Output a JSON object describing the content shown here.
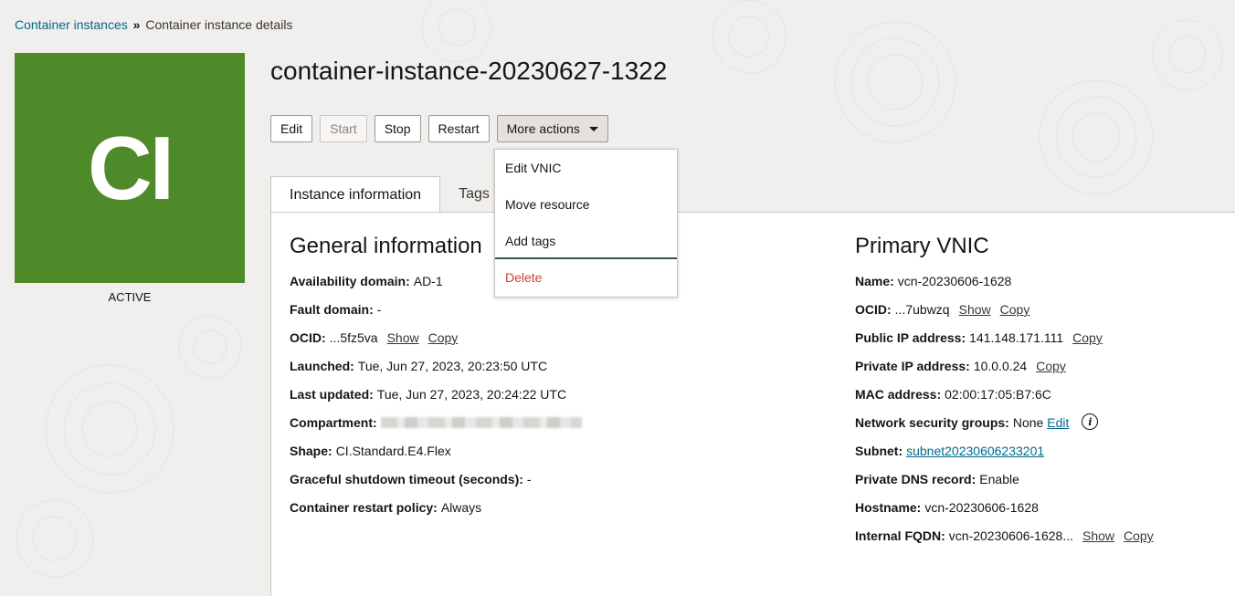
{
  "breadcrumb": {
    "parent": "Container instances",
    "separator": "»",
    "current": "Container instance details"
  },
  "badge": {
    "initials": "CI",
    "status": "ACTIVE",
    "color": "#4f8a2a"
  },
  "title": "container-instance-20230627-1322",
  "toolbar": {
    "edit": "Edit",
    "start": "Start",
    "stop": "Stop",
    "restart": "Restart",
    "more": "More actions"
  },
  "dropdown": {
    "items": [
      "Edit VNIC",
      "Move resource",
      "Add tags",
      "Delete"
    ]
  },
  "tabs": {
    "instance_info": "Instance information",
    "tags": "Tags"
  },
  "general": {
    "title": "General information",
    "availability_domain": {
      "label": "Availability domain:",
      "value": "AD-1"
    },
    "fault_domain": {
      "label": "Fault domain:",
      "value": "-"
    },
    "ocid": {
      "label": "OCID:",
      "value": "...5fz5va",
      "show": "Show",
      "copy": "Copy"
    },
    "launched": {
      "label": "Launched:",
      "value": "Tue, Jun 27, 2023, 20:23:50 UTC"
    },
    "last_updated": {
      "label": "Last updated:",
      "value": "Tue, Jun 27, 2023, 20:24:22 UTC"
    },
    "compartment": {
      "label": "Compartment:"
    },
    "shape": {
      "label": "Shape:",
      "value": "CI.Standard.E4.Flex"
    },
    "graceful_shutdown": {
      "label": "Graceful shutdown timeout (seconds):",
      "value": "-"
    },
    "restart_policy": {
      "label": "Container restart policy:",
      "value": "Always"
    }
  },
  "vnic": {
    "title": "Primary VNIC",
    "name": {
      "label": "Name:",
      "value": "vcn-20230606-1628"
    },
    "ocid": {
      "label": "OCID:",
      "value": "...7ubwzq",
      "show": "Show",
      "copy": "Copy"
    },
    "public_ip": {
      "label": "Public IP address:",
      "value": "141.148.171.111",
      "copy": "Copy"
    },
    "private_ip": {
      "label": "Private IP address:",
      "value": "10.0.0.24",
      "copy": "Copy"
    },
    "mac": {
      "label": "MAC address:",
      "value": "02:00:17:05:B7:6C"
    },
    "nsg": {
      "label": "Network security groups:",
      "value": "None",
      "edit": "Edit"
    },
    "subnet": {
      "label": "Subnet:",
      "value": "subnet20230606233201"
    },
    "dns": {
      "label": "Private DNS record:",
      "value": "Enable"
    },
    "hostname": {
      "label": "Hostname:",
      "value": "vcn-20230606-1628"
    },
    "fqdn": {
      "label": "Internal FQDN:",
      "value": "vcn-20230606-1628...",
      "show": "Show",
      "copy": "Copy"
    }
  }
}
